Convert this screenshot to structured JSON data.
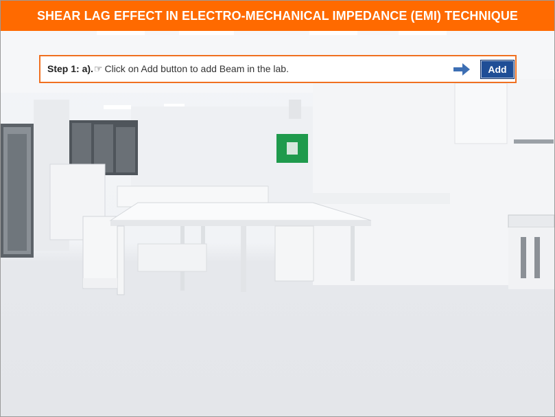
{
  "header": {
    "title": "SHEAR LAG EFFECT IN ELECTRO-MECHANICAL IMPEDANCE (EMI) TECHNIQUE"
  },
  "instruction": {
    "step_label": "Step 1: a).",
    "hand_icon": "pointing-hand-icon",
    "text": "Click on Add button to add Beam in the lab.",
    "arrow_icon": "right-arrow-icon"
  },
  "add_button": {
    "label": "Add"
  },
  "colors": {
    "header_bg": "#ff6a00",
    "instruction_border": "#f07020",
    "button_bg": "#1f4e96",
    "arrow": "#3d6fb4"
  }
}
